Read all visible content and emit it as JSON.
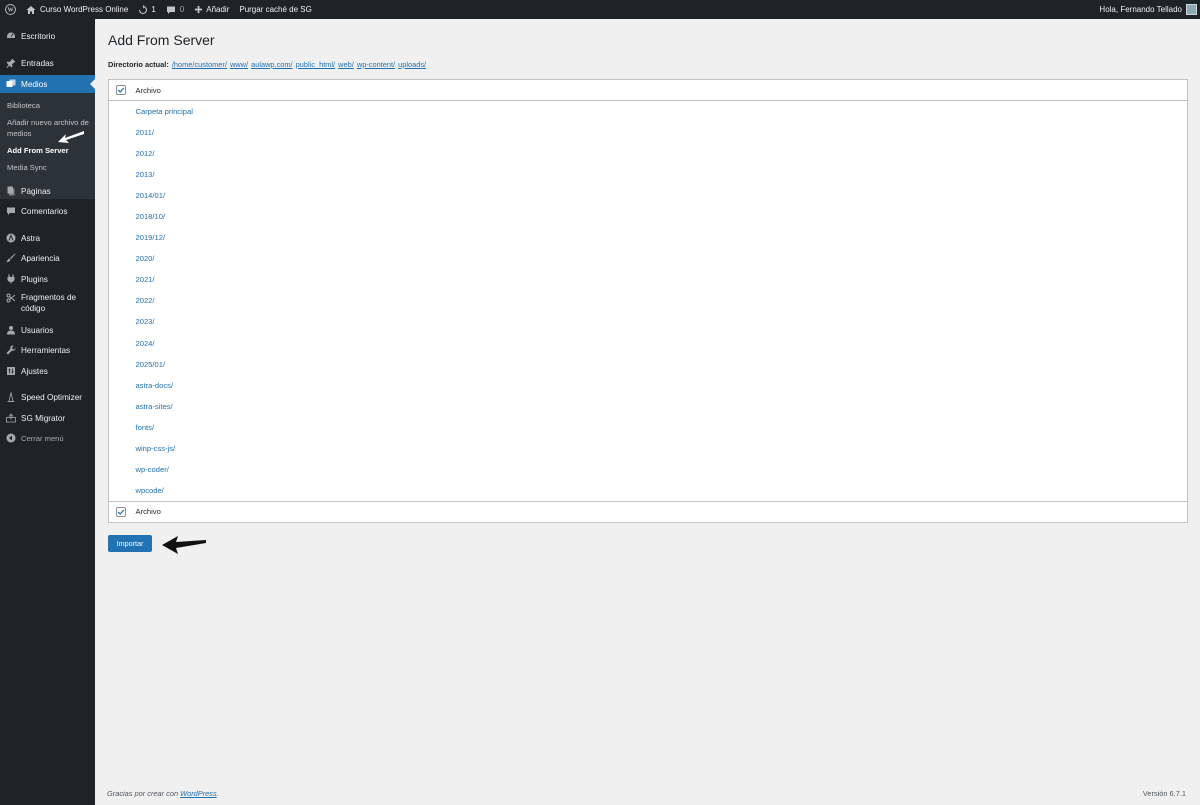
{
  "adminbar": {
    "site_name": "Curso WordPress Online",
    "updates_count": "1",
    "comments_count": "0",
    "new_label": "Añadir",
    "purge_label": "Purgar caché de SG",
    "greeting": "Hola, Fernando Tellado"
  },
  "sidebar": {
    "items": [
      {
        "label": "Escritorio",
        "icon": "dashboard-icon"
      },
      {
        "label": "Entradas",
        "icon": "pin-icon"
      },
      {
        "label": "Medios",
        "icon": "media-icon"
      },
      {
        "label": "Páginas",
        "icon": "pages-icon"
      },
      {
        "label": "Comentarios",
        "icon": "comments-icon"
      },
      {
        "label": "Astra",
        "icon": "astra-icon"
      },
      {
        "label": "Apariencia",
        "icon": "brush-icon"
      },
      {
        "label": "Plugins",
        "icon": "plugin-icon"
      },
      {
        "label": "Fragmentos de código",
        "icon": "code-snippets-icon"
      },
      {
        "label": "Usuarios",
        "icon": "users-icon"
      },
      {
        "label": "Herramientas",
        "icon": "wrench-icon"
      },
      {
        "label": "Ajustes",
        "icon": "settings-icon"
      },
      {
        "label": "Speed Optimizer",
        "icon": "speed-icon"
      },
      {
        "label": "SG Migrator",
        "icon": "migrator-icon"
      },
      {
        "label": "Cerrar menú",
        "icon": "collapse-icon"
      }
    ],
    "submenu": [
      {
        "label": "Biblioteca"
      },
      {
        "label": "Añadir nuevo archivo de medios"
      },
      {
        "label": "Add From Server"
      },
      {
        "label": "Media Sync"
      }
    ]
  },
  "page": {
    "title": "Add From Server",
    "path_label": "Directorio actual:",
    "path_segments": [
      "/home/customer/",
      "www/",
      "aulawp.com/",
      "public_html/",
      "web/",
      "wp-content/",
      "uploads/"
    ],
    "header_label": "Archivo",
    "footer_label": "Archivo",
    "rows": [
      "Carpeta principal",
      "2011/",
      "2012/",
      "2013/",
      "2014/01/",
      "2018/10/",
      "2019/12/",
      "2020/",
      "2021/",
      "2022/",
      "2023/",
      "2024/",
      "2025/01/",
      "astra-docs/",
      "astra-sites/",
      "fonts/",
      "winp-css-js/",
      "wp-coder/",
      "wpcode/"
    ],
    "import_button": "Importar"
  },
  "footer": {
    "thanks_prefix": "Gracias por crear con",
    "thanks_link": "WordPress",
    "thanks_suffix": ".",
    "version": "Versión 6.7.1"
  },
  "colors": {
    "adminbar_bg": "#1d2327",
    "accent": "#2271b1",
    "content_bg": "#f0f0f1"
  }
}
